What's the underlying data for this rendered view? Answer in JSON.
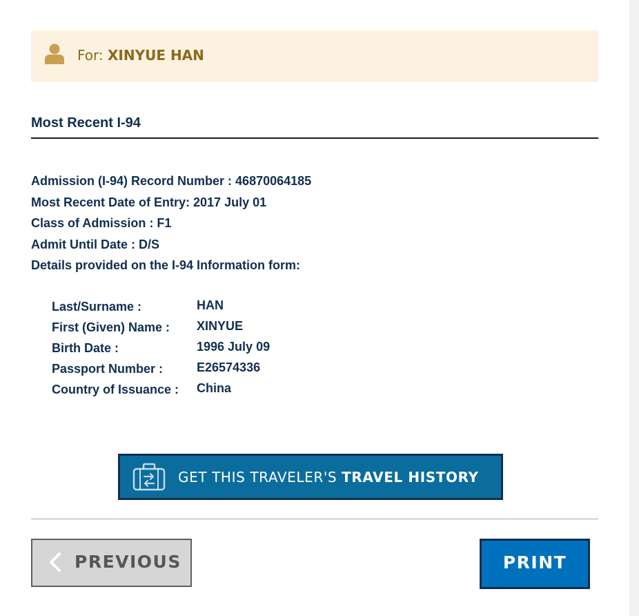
{
  "traveler": {
    "for_label": "For:",
    "name": "XINYUE HAN"
  },
  "section": {
    "title": "Most Recent I-94"
  },
  "record": {
    "lines": [
      "Admission (I-94) Record Number : 46870064185",
      "Most Recent Date of Entry: 2017 July 01",
      "Class of Admission : F1",
      "Admit Until Date : D/S",
      "Details provided on the I-94 Information form:"
    ]
  },
  "details": [
    {
      "label": "Last/Surname :",
      "value": "HAN"
    },
    {
      "label": "First (Given) Name :",
      "value": "XINYUE"
    },
    {
      "label": "Birth Date :",
      "value": "1996 July 09"
    },
    {
      "label": "Passport Number :",
      "value": "E26574336"
    },
    {
      "label": "Country of Issuance :",
      "value": "China"
    }
  ],
  "actions": {
    "travel_history_prefix": "GET THIS TRAVELER'S ",
    "travel_history_bold": "TRAVEL HISTORY",
    "previous_label": "PREVIOUS",
    "print_label": "PRINT"
  },
  "icons": {
    "user": "user-icon",
    "travel": "suitcase-arrows-icon",
    "previous": "chevron-left-icon"
  },
  "colors": {
    "banner_bg": "#fdf2e0",
    "banner_text": "#8a6a1c",
    "heading_text": "#112e51",
    "travel_button": "#0b6d9e",
    "print_button": "#0071bc",
    "previous_button": "#d6d6d6"
  }
}
